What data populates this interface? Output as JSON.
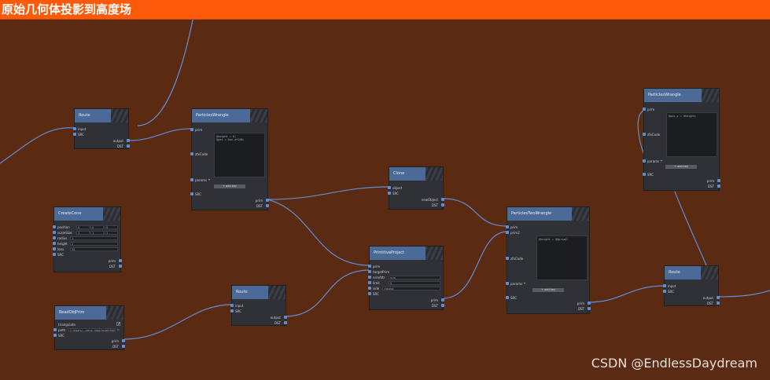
{
  "window": {
    "title": "原始几何体投影到高度场"
  },
  "colors": {
    "background": "#5a2b12",
    "titlebar": "#ff5a0a",
    "node_header": "#4b6a98",
    "wire": "#5f8ed6"
  },
  "watermark": "CSDN @EndlessDaydream",
  "nodes": {
    "route1": {
      "title": "Route",
      "inputs": [
        "input",
        "SRC"
      ],
      "outputs": [
        "output",
        "DST"
      ]
    },
    "wrangle1": {
      "title": "ParticlesWrangle",
      "inputs": [
        "prim",
        "zfxCode",
        "params",
        "SRC"
      ],
      "outputs": [
        "prim",
        "DST"
      ],
      "code": "@height = 0;\n@pos = @uv.x*100;",
      "button": "+ add key",
      "params_select": "▾"
    },
    "clone": {
      "title": "Clone",
      "inputs": [
        "object",
        "SRC"
      ],
      "outputs": [
        "newObject",
        "DST"
      ]
    },
    "create_cone": {
      "title": "CreateCone",
      "inputs": [
        "position",
        "scaleSize",
        "radius",
        "height",
        "lons",
        "SRC"
      ],
      "outputs": [
        "prim",
        "DST"
      ],
      "position_vals": [
        "0",
        "0",
        "0"
      ],
      "scale_vals": [
        "1",
        "1",
        "1"
      ],
      "radius": "1",
      "height": "2",
      "lons": "32"
    },
    "primitive_project": {
      "title": "PrimitiveProject",
      "inputs": [
        "prim",
        "targetPrim",
        "nrmAttr",
        "limit",
        "side",
        "SRC"
      ],
      "outputs": [
        "prim",
        "DST"
      ],
      "nrmAttr": "nrm",
      "limit": "0",
      "side": "closest"
    },
    "read_obj": {
      "title": "ReadObjPrim",
      "inputs": [
        "triangulate",
        "path",
        "SRC"
      ],
      "outputs": [
        "prim",
        "DST"
      ],
      "path": "C:/Users/.../zeno_data/heightfield.obj",
      "check": "✓"
    },
    "route2": {
      "title": "Route",
      "inputs": [
        "input",
        "SRC"
      ],
      "outputs": [
        "output",
        "DST"
      ]
    },
    "two_wrangle": {
      "title": "ParticlesTwoWrangle",
      "inputs": [
        "prim",
        "prim2",
        "zfxCode",
        "params",
        "SRC"
      ],
      "outputs": [
        "prim",
        "DST"
      ],
      "code": "@height = @@prim2;",
      "button": "+ add key",
      "params_select": "▾"
    },
    "wrangle2": {
      "title": "ParticlesWrangle",
      "inputs": [
        "prim",
        "zfxCode",
        "params",
        "SRC"
      ],
      "outputs": [
        "prim",
        "DST"
      ],
      "code": "@pos.y = @height;",
      "button": "+ add key",
      "params_select": "▾"
    },
    "route3": {
      "title": "Route",
      "inputs": [
        "input",
        "SRC"
      ],
      "outputs": [
        "output",
        "DST"
      ]
    }
  }
}
